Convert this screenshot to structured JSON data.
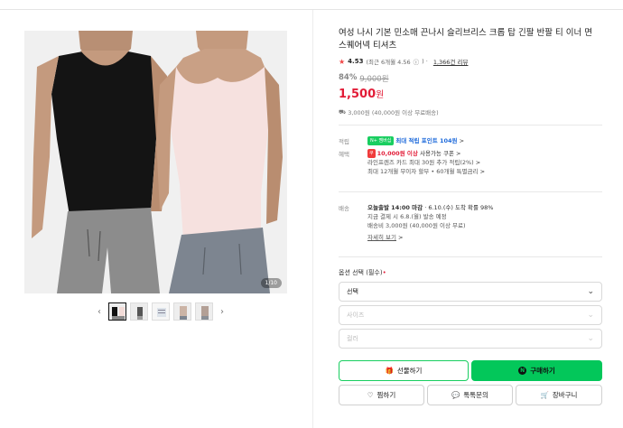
{
  "product": {
    "title": "여성 나시 기본 민소매 끈나시 슬리브리스 크롭 탑 긴팔 반팔 티 이너 면 스퀘어넥 티셔츠",
    "rating": "4.53",
    "rating_sub": "(최근 6개월 4.56",
    "rating_info": "ⓘ",
    "rating_close": ") ·",
    "reviews": "1,366건 리뷰",
    "discount": "84%",
    "original_price": "9,000원",
    "price": "1,500",
    "price_unit": "원",
    "shipping": "3,000원 (40,000원 이상 무료배송)",
    "image_counter": "1/10"
  },
  "benefits": {
    "points_label": "적립",
    "npay_badge": "N+ 멤버십",
    "points_text": "최대 적립 포인트 104원",
    "points_arrow": ">",
    "benefit_label": "혜택",
    "coupon_badge": "쿠",
    "coupon_amount": "10,000원 이상",
    "coupon_text": "사용가능 쿠폰",
    "coupon_arrow": ">",
    "card_text": "라인프렌즈 카드 최대 30원 추가 적립(2%)",
    "card_arrow": ">",
    "installment_text": "최대 12개월 무이자 할부 • 60개월 특별금리",
    "installment_arrow": ">"
  },
  "delivery": {
    "label": "배송",
    "today_strong": "오늘출발 14:00 마감",
    "today_rest": "· 6.10.(수) 도착 확률 98%",
    "pay_now": "지금 결제 시 6.8.(월) 발송 예정",
    "fee": "배송비 3,000원 (40,000원 이상 무료)",
    "details": "자세히 보기",
    "details_arrow": ">"
  },
  "options": {
    "label": "옵션 선택 (필수)",
    "required_mark": "•",
    "selects": [
      {
        "value": "선택",
        "enabled": true
      },
      {
        "value": "사이즈",
        "enabled": false
      },
      {
        "value": "컬러",
        "enabled": false
      }
    ]
  },
  "actions": {
    "gift": "선물하기",
    "buy": "구매하기",
    "buy_logo": "N",
    "wish": "찜하기",
    "talk": "톡톡문의",
    "cart": "장바구니"
  },
  "thumbnails": {
    "prev": "‹",
    "next": "›",
    "count": 5
  },
  "colors": {
    "price_red": "#e21c37",
    "naver_green": "#03c75a",
    "star": "#f04646"
  }
}
